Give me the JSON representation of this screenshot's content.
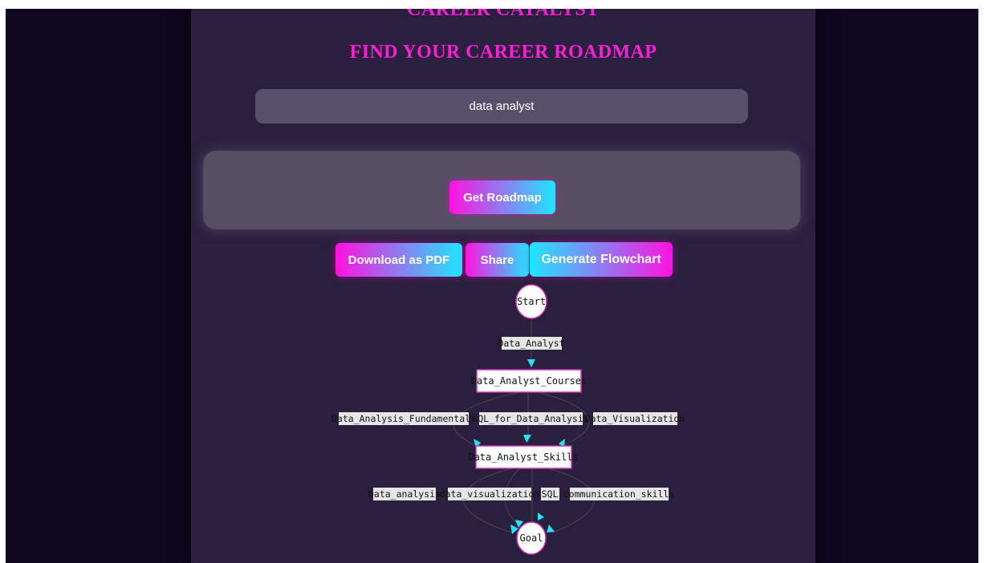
{
  "app": {
    "title": "CAREER CATALYST"
  },
  "page": {
    "heading": "FIND YOUR CAREER ROADMAP"
  },
  "search": {
    "value": "data analyst"
  },
  "buttons": {
    "get_roadmap": "Get Roadmap",
    "download_pdf": "Download as PDF",
    "share": "Share",
    "generate_flowchart": "Generate Flowchart"
  },
  "flowchart": {
    "start": "Start",
    "edge_start": "Data_Analyst",
    "courses": "Data_Analyst_Courses",
    "course_labels": [
      "Data_Analysis_Fundamentals",
      "SQL_for_Data_Analysis",
      "Data_Visualization"
    ],
    "skills": "Data_Analyst_Skills",
    "skill_labels": [
      "Data_analysis",
      "data_visualization",
      "SQL",
      "communication_skills"
    ],
    "goal": "Goal"
  },
  "colors": {
    "accent_magenta": "#ff12e0",
    "accent_cyan": "#1fe6ff",
    "background": "#0f0720",
    "panel": "#2a1f3d"
  }
}
